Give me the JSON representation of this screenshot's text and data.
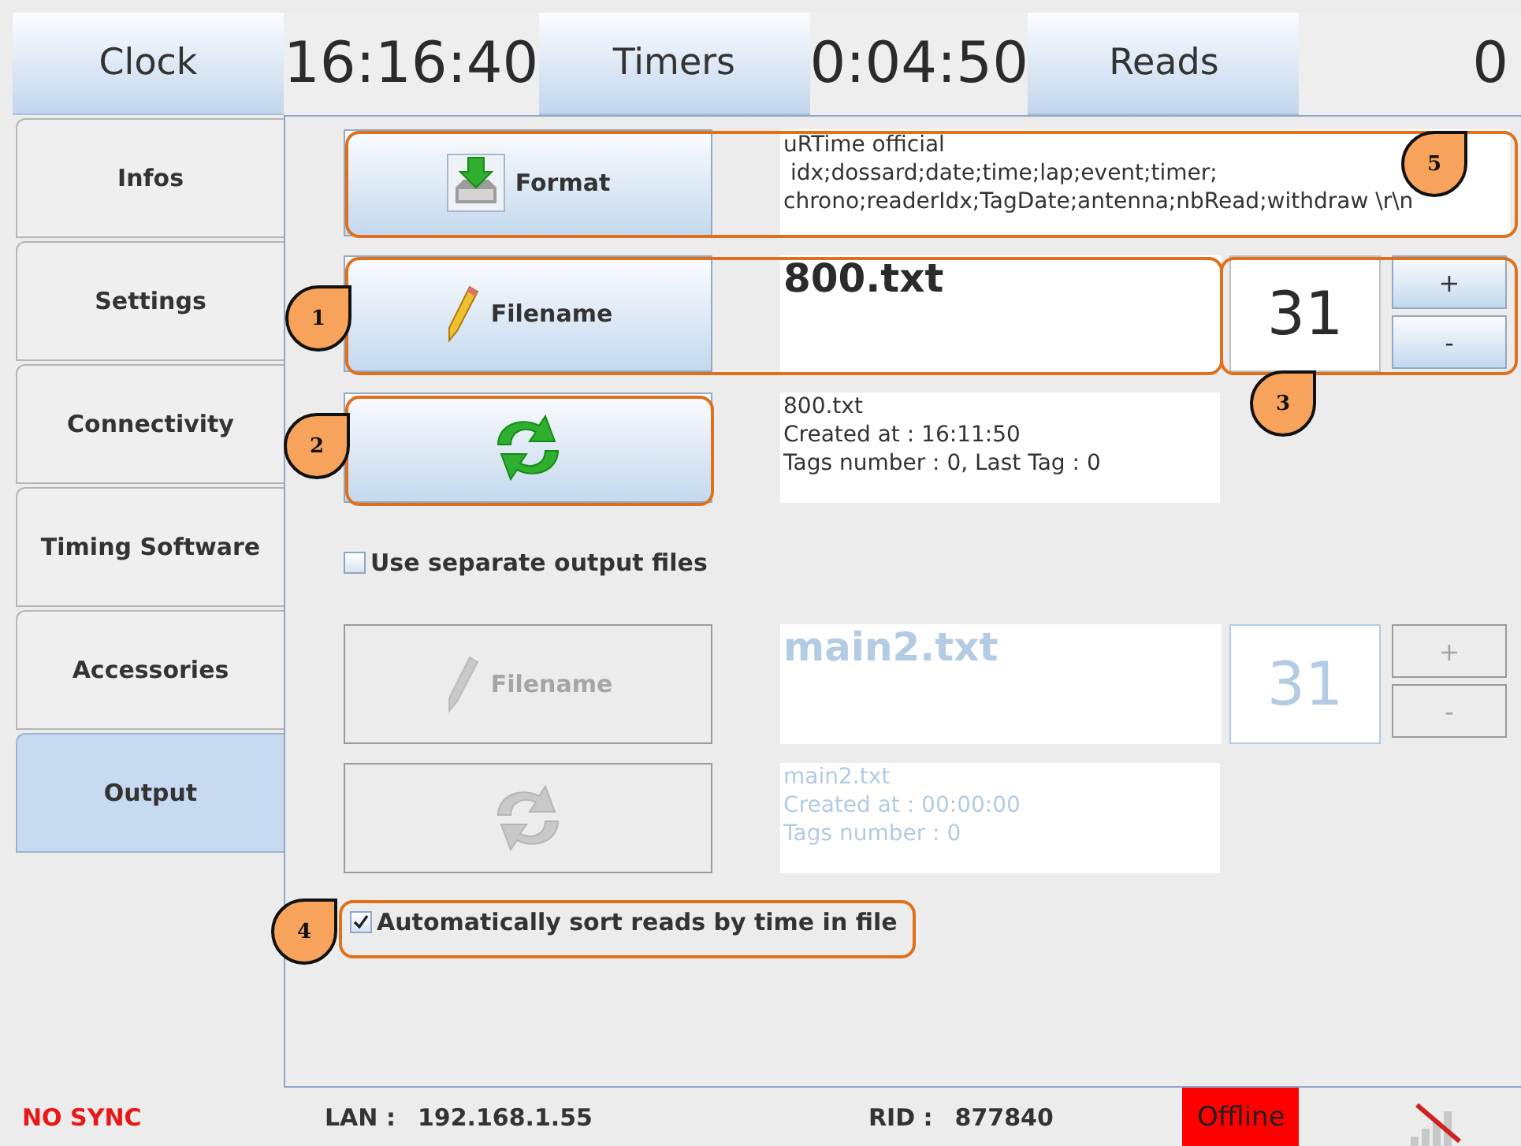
{
  "header": [
    {
      "kind": "label",
      "text": "Clock"
    },
    {
      "kind": "value",
      "text": "16:16:40"
    },
    {
      "kind": "label",
      "text": "Timers"
    },
    {
      "kind": "value",
      "text": "0:04:50"
    },
    {
      "kind": "label",
      "text": "Reads"
    },
    {
      "kind": "value",
      "text": "0"
    }
  ],
  "sidebar": {
    "items": [
      {
        "label": "Infos",
        "selected": false
      },
      {
        "label": "Settings",
        "selected": false
      },
      {
        "label": "Connectivity",
        "selected": false
      },
      {
        "label": "Timing Software",
        "selected": false
      },
      {
        "label": "Accessories",
        "selected": false
      },
      {
        "label": "Output",
        "selected": true
      }
    ]
  },
  "format": {
    "button": "Format",
    "lines": [
      "uRTime official",
      " idx;dossard;date;time;lap;event;timer;",
      "chrono;readerIdx;TagDate;antenna;nbRead;withdraw \\r\\n"
    ]
  },
  "separate_files": {
    "label": "Use separate output files",
    "checked": false
  },
  "outputs": [
    {
      "button": "Filename",
      "filename": "800.txt",
      "number": "31",
      "plus": "+",
      "minus": "-",
      "info": [
        "800.txt",
        "Created at : 16:11:50",
        "Tags number : 0, Last Tag : 0"
      ],
      "disabled": false
    },
    {
      "button": "Filename",
      "filename": "main2.txt",
      "number": "31",
      "plus": "+",
      "minus": "-",
      "info": [
        "main2.txt",
        "Created at : 00:00:00",
        "Tags number : 0"
      ],
      "disabled": true
    }
  ],
  "sort_reads": {
    "label": "Automatically sort reads by time in file",
    "checked": true
  },
  "callouts": [
    {
      "label": "1"
    },
    {
      "label": "2"
    },
    {
      "label": "3"
    },
    {
      "label": "4"
    },
    {
      "label": "5"
    }
  ],
  "status_bar": {
    "sync": "NO SYNC",
    "lan_label": "LAN :",
    "lan": "192.168.1.55",
    "rid_label": "RID :",
    "rid": "877840",
    "connection": "Offline"
  }
}
